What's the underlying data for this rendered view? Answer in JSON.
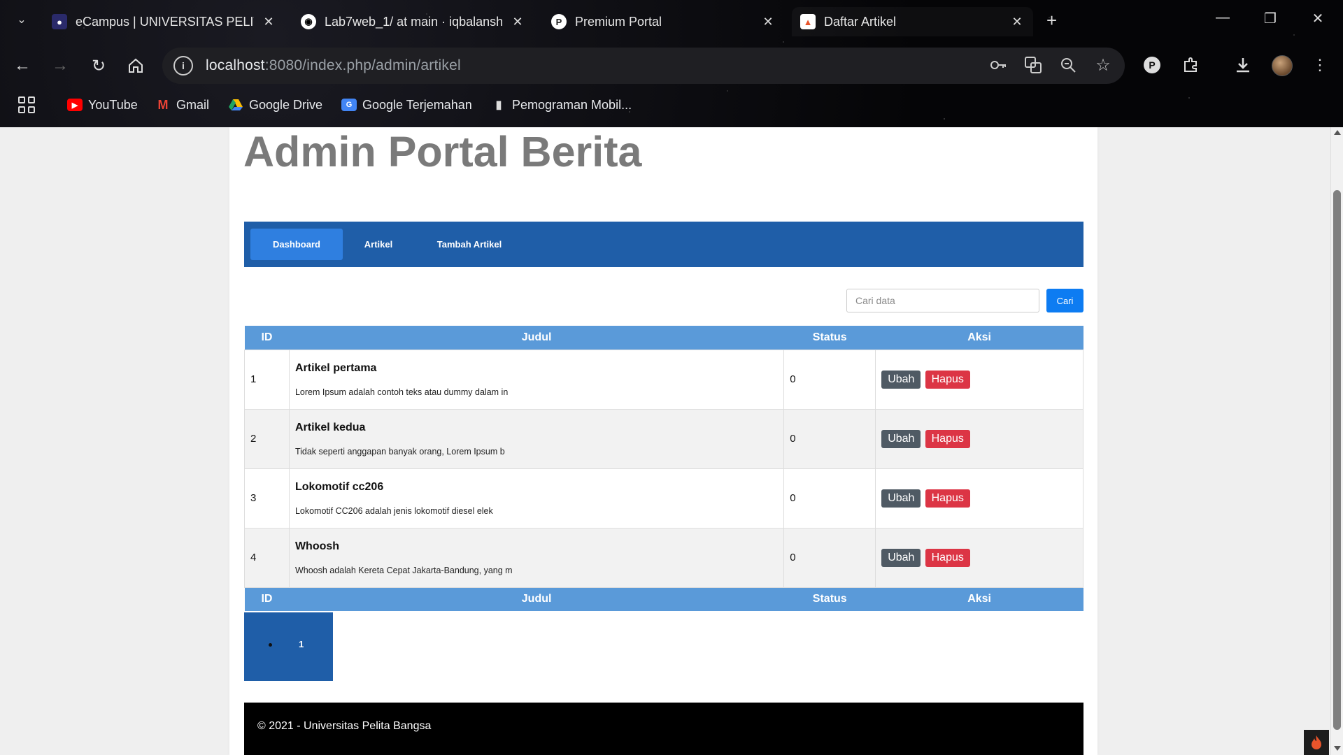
{
  "browser": {
    "tabs": [
      {
        "title": "eCampus | UNIVERSITAS PELITA BANGSA",
        "favicon": "campus-logo-icon",
        "color": "#3b3b8c"
      },
      {
        "title": "Lab7web_1/ at main · iqbalansh",
        "favicon": "github-icon",
        "color": "#ffffff"
      },
      {
        "title": "Premium Portal",
        "favicon": "premium-portal-icon",
        "color": "#ffffff"
      },
      {
        "title": "Daftar Artikel",
        "favicon": "fire-icon",
        "color": "#e8542b"
      }
    ],
    "url_host": "localhost",
    "url_path": ":8080/index.php/admin/artikel",
    "bookmarks": [
      {
        "label": "YouTube",
        "icon": "youtube-icon",
        "color": "#ff0000"
      },
      {
        "label": "Gmail",
        "icon": "gmail-icon",
        "color": "#ea4335"
      },
      {
        "label": "Google Drive",
        "icon": "drive-icon",
        "color": "#1fa463"
      },
      {
        "label": "Google Terjemahan",
        "icon": "translate-icon",
        "color": "#4285f4"
      },
      {
        "label": "Pemograman Mobil...",
        "icon": "bookmark-page-icon",
        "color": "#dddddd"
      }
    ]
  },
  "page": {
    "title": "Admin Portal Berita",
    "nav": [
      {
        "label": "Dashboard",
        "active": true
      },
      {
        "label": "Artikel",
        "active": false
      },
      {
        "label": "Tambah Artikel",
        "active": false
      }
    ],
    "search": {
      "placeholder": "Cari data",
      "button": "Cari"
    },
    "table": {
      "headers": [
        "ID",
        "Judul",
        "Status",
        "Aksi"
      ],
      "rows": [
        {
          "id": "1",
          "title": "Artikel pertama",
          "excerpt": "Lorem Ipsum adalah contoh teks atau dummy dalam in",
          "status": "0"
        },
        {
          "id": "2",
          "title": "Artikel kedua",
          "excerpt": "Tidak seperti anggapan banyak orang, Lorem Ipsum b",
          "status": "0"
        },
        {
          "id": "3",
          "title": "Lokomotif cc206",
          "excerpt": "Lokomotif CC206 adalah jenis lokomotif diesel elek",
          "status": "0"
        },
        {
          "id": "4",
          "title": "Whoosh",
          "excerpt": "Whoosh adalah Kereta Cepat Jakarta-Bandung, yang m",
          "status": "0"
        }
      ],
      "edit_label": "Ubah",
      "delete_label": "Hapus"
    },
    "pagination": {
      "current": "1"
    },
    "footer": "© 2021 - Universitas Pelita Bangsa"
  },
  "colors": {
    "nav_bg": "#1f5ea8",
    "nav_active": "#2f7fe0",
    "table_header": "#5a9ad9",
    "search_button": "#0d7cf2",
    "edit_button": "#4f5a64",
    "delete_button": "#dc3545"
  }
}
